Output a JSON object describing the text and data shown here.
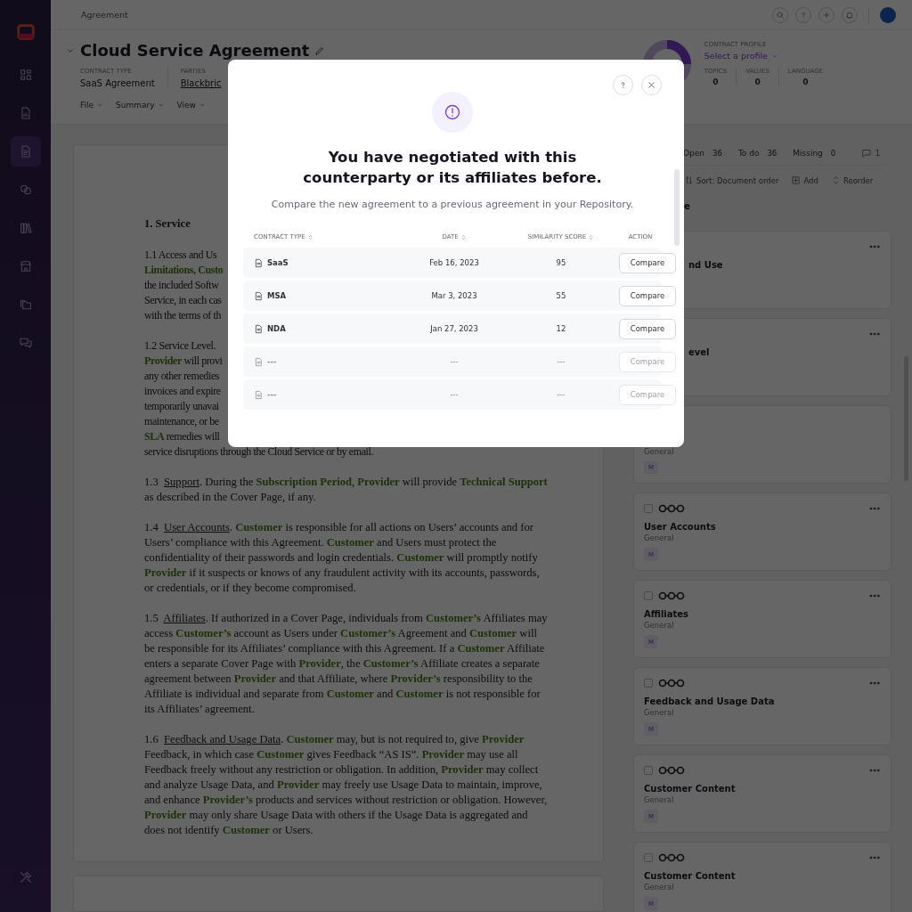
{
  "sidebar": {
    "items": [
      {
        "kind": "logo",
        "selected": false
      },
      {
        "kind": "grid",
        "selected": false
      },
      {
        "kind": "report",
        "selected": false
      },
      {
        "kind": "document",
        "selected": true
      },
      {
        "kind": "links",
        "selected": false
      },
      {
        "kind": "library",
        "selected": false
      },
      {
        "kind": "store",
        "selected": false
      },
      {
        "kind": "folders",
        "selected": false
      },
      {
        "kind": "chat",
        "selected": false
      }
    ],
    "bottom_item": {
      "kind": "tools"
    }
  },
  "top_bar": {
    "breadcrumb": "Agreement"
  },
  "header": {
    "title": "Cloud Service Agreement",
    "fields": [
      {
        "label": "CONTRACT TYPE",
        "value": "SaaS Agreement",
        "kind": "text"
      },
      {
        "label": "PARTIES",
        "value": "Blackbric",
        "kind": "link"
      }
    ],
    "menus": [
      "File",
      "Summary",
      "View"
    ],
    "profile": {
      "label": "CONTRACT PROFILE",
      "select": "Select a profile",
      "stats": [
        {
          "label": "TOPICS",
          "value": "0"
        },
        {
          "label": "VALUES",
          "value": "0"
        },
        {
          "label": "LANGUAGE",
          "value": "0"
        }
      ]
    }
  },
  "document": {
    "heading": "1. Service",
    "cut_paragraphs": [
      [
        "1.1  Access and Us",
        "**Limitations, Custo**",
        "the included Softw",
        "Service, in each cas",
        "with the terms of th"
      ],
      [
        "1.2  Service Level. ",
        "**Provider** will provi",
        "any other remedies",
        "invoices and expire",
        "temporarily unavai",
        "maintenance, or be",
        "**SLA** remedies will",
        "service disruptions through the Cloud Service or by email."
      ]
    ],
    "paragraphs": [
      {
        "number": "1.3",
        "heading": "Support",
        "text": ". During the **Subscription Period**, **Provider** will provide **Technical Support** as described in the Cover Page, if any."
      },
      {
        "number": "1.4",
        "heading": "User Accounts",
        "text": ". **Customer** is responsible for all actions on Users’ accounts and for Users’ compliance with this Agreement. **Customer** and Users must protect the confidentiality of their passwords and login credentials. **Customer** will promptly notify **Provider** if it suspects or knows of any fraudulent activity with its accounts, passwords, or credentials, or if they become compromised."
      },
      {
        "number": "1.5",
        "heading": "Affiliates",
        "text": ". If authorized in a Cover Page, individuals from **Customer’s** Affiliates may access **Customer’s** account as Users under **Customer’s** Agreement and **Customer** will be responsible for its Affiliates’ compliance with this Agreement. If a **Customer** Affiliate enters a separate Cover Page with **Provider**, the **Customer’s** Affiliate creates a separate agreement between **Provider** and that Affiliate, where **Provider’s** responsibility to the Affiliate is individual and separate from **Customer** and **Customer** is not responsible for its Affiliates’ agreement."
      },
      {
        "number": "1.6",
        "heading": "Feedback and Usage Data",
        "text": ". **Customer** may, but is not required to, give **Provider** Feedback, in which case **Customer** gives Feedback  “AS IS”. **Provider** may use all Feedback freely without any restriction or obligation. In addition, **Provider** may collect and analyze Usage Data, and **Provider** may freely use Usage Data to maintain, improve, and enhance **Provider’s** products and services without restriction or obligation. However, **Provider** may only share Usage Data with others if the Usage Data is aggregated and does not identify **Customer** or Users."
      }
    ]
  },
  "review_panel": {
    "tabs": [
      {
        "label": "Open",
        "count": "36"
      },
      {
        "label": "To do",
        "count": "36"
      },
      {
        "label": "Missing",
        "count": "0"
      }
    ],
    "comments": "1",
    "tools": [
      {
        "kind": "sort",
        "label": "Sort: Document order"
      },
      {
        "kind": "add",
        "label": "Add"
      },
      {
        "kind": "reorder",
        "label": "Reorder"
      }
    ],
    "section_fragment": "e",
    "cards": [
      {
        "kind": "partial",
        "title": "nd Use"
      },
      {
        "kind": "partial",
        "title": "evel"
      },
      {
        "kind": "lower",
        "category": "General",
        "badge": "M"
      },
      {
        "kind": "full",
        "title": "User Accounts",
        "category": "General",
        "badge": "M",
        "checked": false
      },
      {
        "kind": "full",
        "title": "Affiliates",
        "category": "General",
        "badge": "M",
        "checked": false
      },
      {
        "kind": "full",
        "title": "Feedback and Usage Data",
        "category": "General",
        "badge": "M",
        "checked": false
      },
      {
        "kind": "full",
        "title": "Customer Content",
        "category": "General",
        "badge": "M",
        "checked": false
      },
      {
        "kind": "full",
        "title": "Customer Content",
        "category": "General",
        "badge": "M",
        "checked": false
      }
    ]
  },
  "modal": {
    "title": "You have negotiated with this counterparty or its affiliates before.",
    "subtitle": "Compare the new agreement to a previous agreement in your Repository.",
    "columns": [
      {
        "label": "CONTRACT TYPE",
        "sortable": true
      },
      {
        "label": "DATE",
        "sortable": true
      },
      {
        "label": "SIMILARITY SCORE",
        "sortable": true
      },
      {
        "label": "ACTION",
        "sortable": false
      }
    ],
    "rows": [
      {
        "type": "SaaS",
        "date": "Feb 16, 2023",
        "score": "95",
        "action": "Compare",
        "disabled": false
      },
      {
        "type": "MSA",
        "date": "Mar 3, 2023",
        "score": "55",
        "action": "Compare",
        "disabled": false
      },
      {
        "type": "NDA",
        "date": "Jan 27, 2023",
        "score": "12",
        "action": "Compare",
        "disabled": false
      },
      {
        "type": "---",
        "date": "---",
        "score": "---",
        "action": "Compare",
        "disabled": true
      },
      {
        "type": "---",
        "date": "---",
        "score": "---",
        "action": "Compare",
        "disabled": true
      }
    ]
  }
}
